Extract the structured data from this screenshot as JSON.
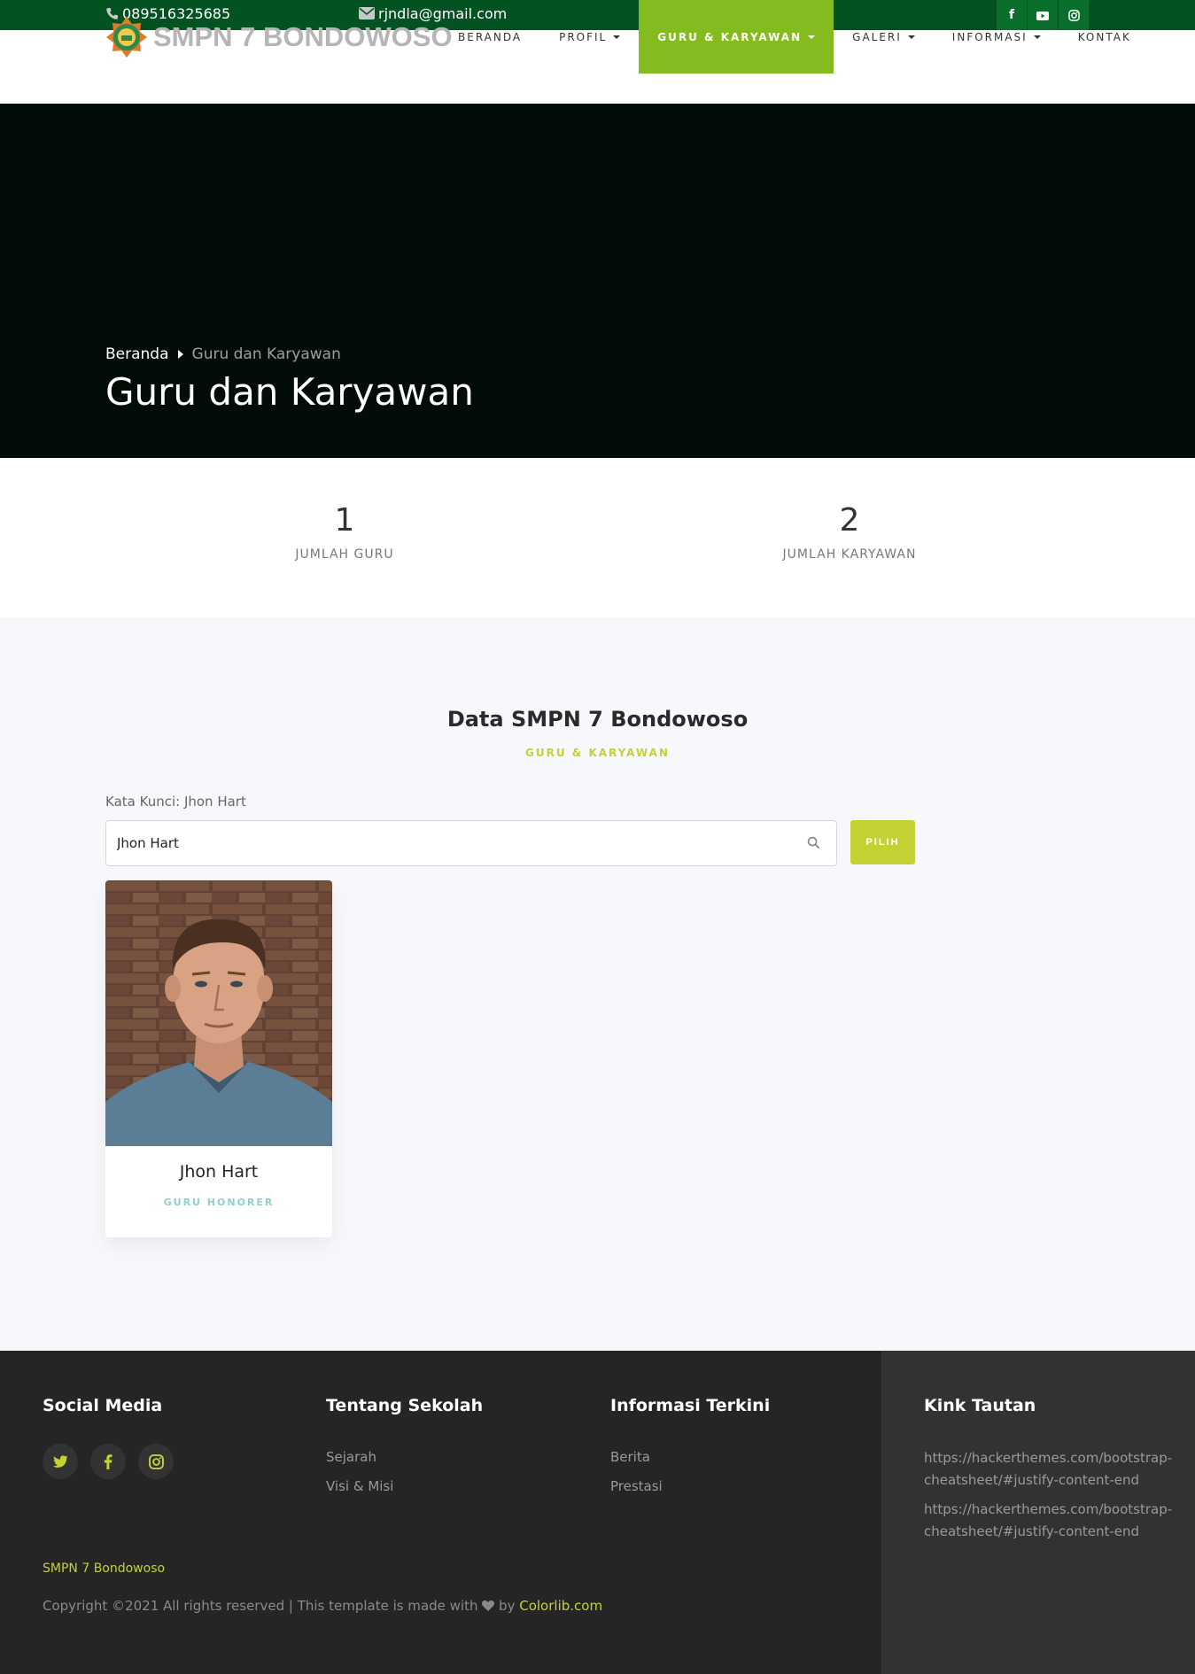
{
  "topbar": {
    "phone": "089516325685",
    "email": "rjndla@gmail.com",
    "social": [
      "facebook-icon",
      "youtube-icon",
      "instagram-icon"
    ]
  },
  "nav": {
    "brand": "SMPN 7 BONDOWOSO",
    "items": [
      {
        "label": "BERANDA",
        "dropdown": false,
        "active": false
      },
      {
        "label": "PROFIL",
        "dropdown": true,
        "active": false
      },
      {
        "label": "GURU & KARYAWAN",
        "dropdown": true,
        "active": true
      },
      {
        "label": "GALERI",
        "dropdown": true,
        "active": false
      },
      {
        "label": "INFORMASI",
        "dropdown": true,
        "active": false
      },
      {
        "label": "KONTAK",
        "dropdown": false,
        "active": false
      }
    ]
  },
  "hero": {
    "breadcrumb_home": "Beranda",
    "breadcrumb_current": "Guru dan Karyawan",
    "title": "Guru dan Karyawan"
  },
  "counters": [
    {
      "value": "1",
      "label": "JUMLAH GURU"
    },
    {
      "value": "2",
      "label": "JUMLAH KARYAWAN"
    }
  ],
  "data_section": {
    "title": "Data SMPN 7 Bondowoso",
    "subtitle": "GURU & KARYAWAN",
    "keyword_label": "Kata Kunci: Jhon Hart",
    "search_value": "Jhon Hart",
    "select_button": "PILIH"
  },
  "cards": [
    {
      "name": "Jhon Hart",
      "role": "GURU HONORER"
    }
  ],
  "footer": {
    "social_title": "Social Media",
    "about_title": "Tentang Sekolah",
    "about_links": [
      "Sejarah",
      "Visi & Misi"
    ],
    "info_title": "Informasi Terkini",
    "info_links": [
      "Berita",
      "Prestasi"
    ],
    "links_title": "Kink Tautan",
    "links": [
      "https://hackerthemes.com/bootstrap-cheatsheet/#justify-content-end",
      "https://hackerthemes.com/bootstrap-cheatsheet/#justify-content-end"
    ],
    "brand": "SMPN 7 Bondowoso",
    "copyright": "Copyright ©2021 All rights reserved | This template is made with",
    "by": "by",
    "credit": "Colorlib.com"
  },
  "colors": {
    "topbar": "#035222",
    "nav_active": "#84bb1e",
    "accent": "#c4d132",
    "hero_bg": "#010d06",
    "footer_bg": "#252525"
  }
}
